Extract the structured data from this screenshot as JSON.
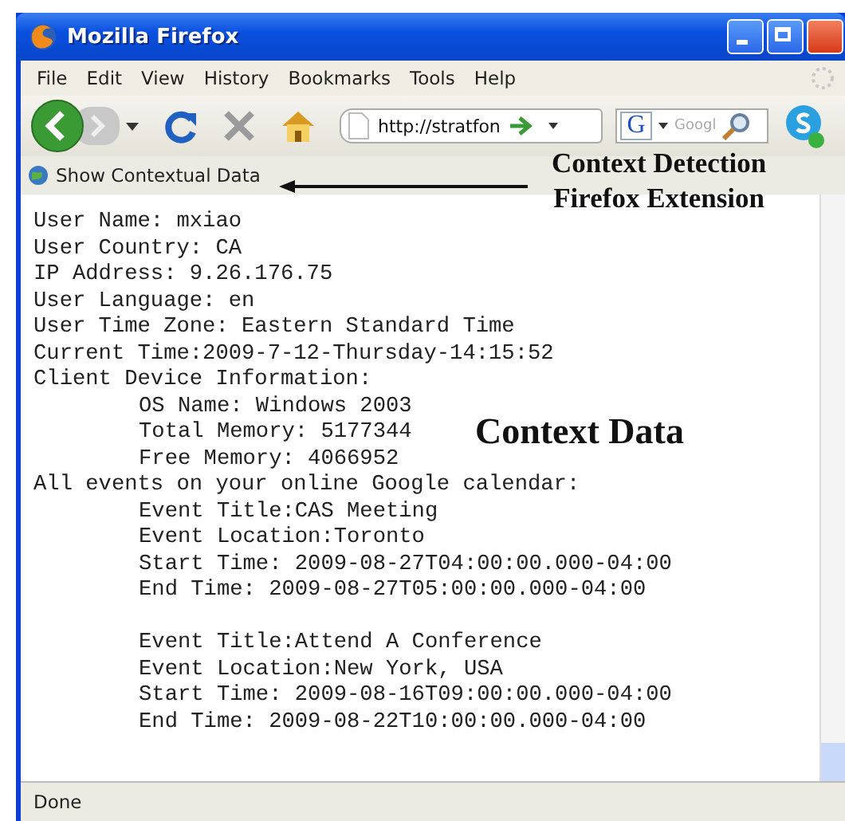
{
  "window": {
    "title": "Mozilla Firefox"
  },
  "menu": [
    {
      "label": "File"
    },
    {
      "label": "Edit"
    },
    {
      "label": "View"
    },
    {
      "label": "History"
    },
    {
      "label": "Bookmarks"
    },
    {
      "label": "Tools"
    },
    {
      "label": "Help"
    }
  ],
  "toolbar": {
    "address": "http://stratfon",
    "search_engine": "G",
    "search_placeholder": "Googl"
  },
  "extension_bar": {
    "label": "Show Contextual Data"
  },
  "content": [
    {
      "text": "User Name: mxiao"
    },
    {
      "text": "User Country: CA"
    },
    {
      "text": "IP Address: 9.26.176.75"
    },
    {
      "text": "User Language: en"
    },
    {
      "text": "User Time Zone: Eastern Standard Time"
    },
    {
      "text": "Current Time:2009-7-12-Thursday-14:15:52"
    },
    {
      "text": "Client Device Information:",
      "children": [
        {
          "text": "OS Name: Windows 2003"
        },
        {
          "text": "Total Memory: 5177344"
        },
        {
          "text": "Free Memory: 4066952"
        }
      ]
    },
    {
      "text": "All events on your online Google calendar:",
      "groups": [
        {
          "lines": [
            "Event Title:CAS Meeting",
            "Event Location:Toronto",
            "Start Time: 2009-08-27T04:00:00.000-04:00",
            "End Time: 2009-08-27T05:00:00.000-04:00"
          ]
        },
        {
          "lines": [
            "Event Title:Attend A Conference",
            "Event Location:New York, USA",
            "Start Time: 2009-08-16T09:00:00.000-04:00",
            "End Time: 2009-08-22T10:00:00.000-04:00"
          ]
        }
      ]
    }
  ],
  "annotations": [
    {
      "kind": "callout",
      "lines": [
        "Context Detection",
        "Firefox Extension"
      ]
    },
    {
      "kind": "label",
      "lines": [
        "Context Data"
      ]
    }
  ],
  "status_bar": {
    "text": "Done"
  }
}
